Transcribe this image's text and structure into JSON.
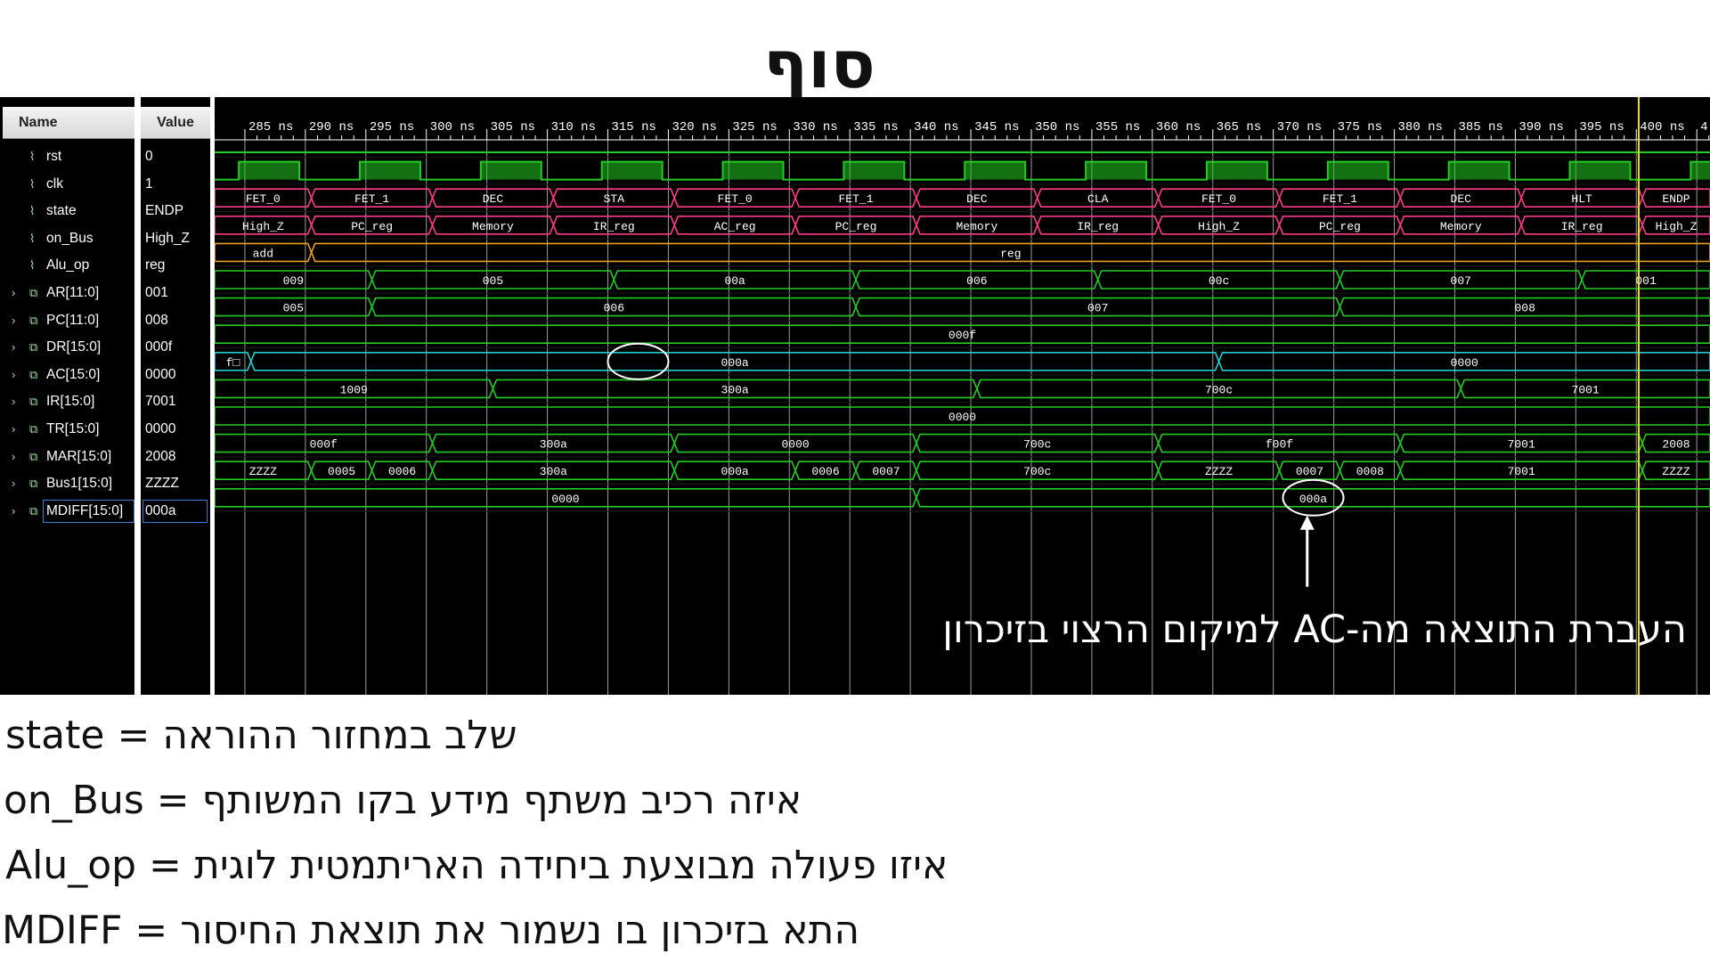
{
  "title": "סוף",
  "columns": {
    "name": "Name",
    "value": "Value"
  },
  "signals": [
    {
      "name": "rst",
      "value": "0",
      "icon": "bit-signal-icon",
      "expandable": false
    },
    {
      "name": "clk",
      "value": "1",
      "icon": "bit-signal-icon",
      "expandable": false
    },
    {
      "name": "state",
      "value": "ENDP",
      "icon": "bit-signal-icon",
      "expandable": false
    },
    {
      "name": "on_Bus",
      "value": "High_Z",
      "icon": "bit-signal-icon",
      "expandable": false
    },
    {
      "name": "Alu_op",
      "value": "reg",
      "icon": "bit-signal-icon",
      "expandable": false
    },
    {
      "name": "AR[11:0]",
      "value": "001",
      "icon": "bus-signal-icon",
      "expandable": true
    },
    {
      "name": "PC[11:0]",
      "value": "008",
      "icon": "bus-signal-icon",
      "expandable": true
    },
    {
      "name": "DR[15:0]",
      "value": "000f",
      "icon": "bus-signal-icon",
      "expandable": true
    },
    {
      "name": "AC[15:0]",
      "value": "0000",
      "icon": "bus-signal-icon",
      "expandable": true
    },
    {
      "name": "IR[15:0]",
      "value": "7001",
      "icon": "bus-signal-icon",
      "expandable": true
    },
    {
      "name": "TR[15:0]",
      "value": "0000",
      "icon": "bus-signal-icon",
      "expandable": true
    },
    {
      "name": "MAR[15:0]",
      "value": "2008",
      "icon": "bus-signal-icon",
      "expandable": true
    },
    {
      "name": "Bus1[15:0]",
      "value": "ZZZZ",
      "icon": "bus-signal-icon",
      "expandable": true
    },
    {
      "name": "MDIFF[15:0]",
      "value": "000a",
      "icon": "bus-signal-icon",
      "expandable": true,
      "selected": true
    }
  ],
  "timeline": {
    "unit": "ns",
    "ticks": [
      "285 ns",
      "290 ns",
      "295 ns",
      "300 ns",
      "305 ns",
      "310 ns",
      "315 ns",
      "320 ns",
      "325 ns",
      "330 ns",
      "335 ns",
      "340 ns",
      "345 ns",
      "350 ns",
      "355 ns",
      "360 ns",
      "365 ns",
      "370 ns",
      "375 ns",
      "380 ns",
      "385 ns",
      "390 ns",
      "395 ns",
      "400 ns",
      "4"
    ],
    "cursor_ns": 400
  },
  "waves": {
    "rst": {
      "kind": "bit",
      "color": "#22cc22",
      "levels": [
        [
          282,
          0
        ]
      ]
    },
    "clk": {
      "kind": "clock",
      "color": "#22cc22",
      "period_ns": 10,
      "first_rise_ns": 282
    },
    "state": {
      "kind": "bus",
      "color": "#ff3a8a",
      "segments": [
        [
          280,
          "FET_0"
        ],
        [
          288,
          "FET_1"
        ],
        [
          298,
          "DEC"
        ],
        [
          308,
          "STA"
        ],
        [
          318,
          "FET_0"
        ],
        [
          328,
          "FET_1"
        ],
        [
          338,
          "DEC"
        ],
        [
          348,
          "CLA"
        ],
        [
          358,
          "FET_0"
        ],
        [
          368,
          "FET_1"
        ],
        [
          378,
          "DEC"
        ],
        [
          388,
          "HLT"
        ],
        [
          398,
          "ENDP"
        ]
      ]
    },
    "on_Bus": {
      "kind": "bus",
      "color": "#ff3a8a",
      "segments": [
        [
          280,
          "High_Z"
        ],
        [
          288,
          "PC_reg"
        ],
        [
          298,
          "Memory"
        ],
        [
          308,
          "IR_reg"
        ],
        [
          318,
          "AC_reg"
        ],
        [
          328,
          "PC_reg"
        ],
        [
          338,
          "Memory"
        ],
        [
          348,
          "IR_reg"
        ],
        [
          358,
          "High_Z"
        ],
        [
          368,
          "PC_reg"
        ],
        [
          378,
          "Memory"
        ],
        [
          388,
          "IR_reg"
        ],
        [
          398,
          "High_Z"
        ]
      ]
    },
    "Alu_op": {
      "kind": "bus",
      "color": "#e8a020",
      "segments": [
        [
          280,
          "add"
        ],
        [
          288,
          "reg"
        ]
      ]
    },
    "AR[11:0]": {
      "kind": "bus",
      "color": "#22cc22",
      "segments": [
        [
          280,
          "009"
        ],
        [
          293,
          "005"
        ],
        [
          313,
          "00a"
        ],
        [
          333,
          "006"
        ],
        [
          353,
          "00c"
        ],
        [
          373,
          "007"
        ],
        [
          393,
          "001"
        ]
      ]
    },
    "PC[11:0]": {
      "kind": "bus",
      "color": "#22cc22",
      "segments": [
        [
          280,
          "005"
        ],
        [
          293,
          "006"
        ],
        [
          333,
          "007"
        ],
        [
          373,
          "008"
        ]
      ]
    },
    "DR[15:0]": {
      "kind": "bus",
      "color": "#22cc22",
      "segments": [
        [
          280,
          "000f"
        ]
      ]
    },
    "AC[15:0]": {
      "kind": "bus",
      "color": "#22cccc",
      "segments": [
        [
          280,
          "f□"
        ],
        [
          283,
          "000a"
        ],
        [
          363,
          "0000"
        ]
      ]
    },
    "IR[15:0]": {
      "kind": "bus",
      "color": "#22cc22",
      "segments": [
        [
          280,
          "1009"
        ],
        [
          303,
          "300a"
        ],
        [
          343,
          "700c"
        ],
        [
          383,
          "7001"
        ]
      ]
    },
    "TR[15:0]": {
      "kind": "bus",
      "color": "#22cc22",
      "segments": [
        [
          280,
          "0000"
        ]
      ]
    },
    "MAR[15:0]": {
      "kind": "bus",
      "color": "#22cc22",
      "segments": [
        [
          280,
          "000f"
        ],
        [
          298,
          "300a"
        ],
        [
          318,
          "0000"
        ],
        [
          338,
          "700c"
        ],
        [
          358,
          "f00f"
        ],
        [
          378,
          "7001"
        ],
        [
          398,
          "2008"
        ]
      ]
    },
    "Bus1[15:0]": {
      "kind": "bus",
      "color": "#22cc22",
      "segments": [
        [
          280,
          "ZZZZ"
        ],
        [
          288,
          "0005"
        ],
        [
          293,
          "0006"
        ],
        [
          298,
          "300a"
        ],
        [
          318,
          "000a"
        ],
        [
          328,
          "0006"
        ],
        [
          333,
          "0007"
        ],
        [
          338,
          "700c"
        ],
        [
          358,
          "ZZZZ"
        ],
        [
          368,
          "0007"
        ],
        [
          373,
          "0008"
        ],
        [
          378,
          "7001"
        ],
        [
          398,
          "ZZZZ"
        ]
      ]
    },
    "MDIFF[15:0]": {
      "kind": "bus",
      "color": "#22cc22",
      "segments": [
        [
          280,
          "0000"
        ],
        [
          338,
          "000a"
        ]
      ]
    }
  },
  "annotation": "העברת התוצאה מה-AC למיקום הרצוי בזיכרון",
  "legend": [
    "state = שלב במחזור ההוראה",
    "on_Bus = איזה רכיב משתף מידע בקו המשותף",
    "Alu_op = איזו פעולה מבוצעת ביחידה האריתמטית לוגית",
    "MDIFF = התא בזיכרון בו נשמור את תוצאת החיסור"
  ],
  "colors": {
    "cursor": "#e8e020",
    "grid": "#d0d0d0",
    "marker": "#ffffff"
  }
}
